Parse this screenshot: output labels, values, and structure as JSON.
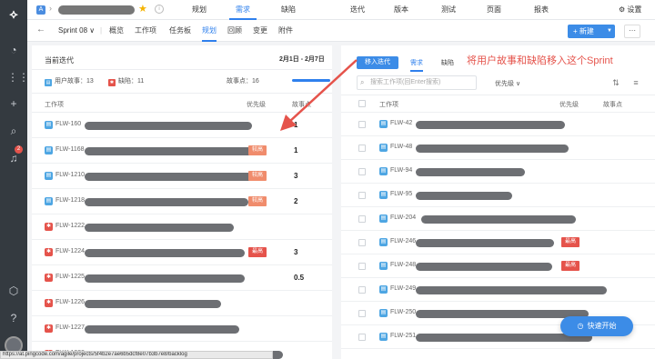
{
  "topbar": {
    "project_icon": "project-icon",
    "nav": [
      {
        "label": "规划",
        "active": false
      },
      {
        "label": "需求",
        "active": true
      },
      {
        "label": "缺陷",
        "active": false
      },
      {
        "label": "迭代",
        "active": false
      },
      {
        "label": "版本",
        "active": false
      },
      {
        "label": "测试",
        "active": false
      },
      {
        "label": "页面",
        "active": false
      },
      {
        "label": "报表",
        "active": false
      }
    ],
    "settings_label": "设置"
  },
  "subbar": {
    "sprint_select": "Sprint 08 ∨",
    "tabs": [
      {
        "label": "概览",
        "active": false
      },
      {
        "label": "工作项",
        "active": false
      },
      {
        "label": "任务板",
        "active": false
      },
      {
        "label": "规划",
        "active": true
      },
      {
        "label": "回顾",
        "active": false
      },
      {
        "label": "变更",
        "active": false
      },
      {
        "label": "附件",
        "active": false
      }
    ],
    "new_button": "+ 新建"
  },
  "left_panel": {
    "title": "当前迭代",
    "dates": "2月1日 - 2月7日",
    "stats": {
      "stories_label": "用户故事",
      "stories_count": "13",
      "bugs_label": "缺陷",
      "bugs_count": "11",
      "points_label": "故事点",
      "points_count": "16"
    },
    "columns": {
      "item": "工作项",
      "priority": "优先级",
      "points": "故事点"
    },
    "rows": [
      {
        "type": "story",
        "code": "FLW-160",
        "priority": "",
        "points": "1"
      },
      {
        "type": "story",
        "code": "FLW-1168",
        "priority": "较高",
        "points": "1"
      },
      {
        "type": "story",
        "code": "FLW-1210",
        "priority": "较高",
        "points": "3"
      },
      {
        "type": "story",
        "code": "FLW-1218",
        "priority": "较高",
        "points": "2"
      },
      {
        "type": "bug",
        "code": "FLW-1222",
        "priority": "",
        "points": ""
      },
      {
        "type": "bug",
        "code": "FLW-1224",
        "priority": "最高",
        "points": "3"
      },
      {
        "type": "bug",
        "code": "FLW-1225",
        "priority": "",
        "points": "0.5"
      },
      {
        "type": "bug",
        "code": "FLW-1226",
        "priority": "",
        "points": ""
      },
      {
        "type": "bug",
        "code": "FLW-1227",
        "priority": "",
        "points": ""
      },
      {
        "type": "bug",
        "code": "FLW-1229",
        "priority": "",
        "points": ""
      }
    ]
  },
  "right_panel": {
    "move_button": "移入迭代",
    "tabs": [
      {
        "label": "需求",
        "active": true
      },
      {
        "label": "缺陷",
        "active": false
      }
    ],
    "annotation": "将用户故事和缺陷移入这个Sprint",
    "search_placeholder": "搜索工作项(回Enter搜索)",
    "priority_filter": "优先级 ∨",
    "columns": {
      "item": "工作项",
      "priority": "优先级",
      "points": "故事点"
    },
    "rows": [
      {
        "type": "story",
        "code": "FLW-42",
        "priority": ""
      },
      {
        "type": "story",
        "code": "FLW-48",
        "priority": ""
      },
      {
        "type": "story",
        "code": "FLW-94",
        "priority": ""
      },
      {
        "type": "story",
        "code": "FLW-95",
        "priority": ""
      },
      {
        "type": "story",
        "code": "FLW-204",
        "priority": ""
      },
      {
        "type": "story",
        "code": "FLW-246",
        "priority": "最高"
      },
      {
        "type": "story",
        "code": "FLW-248",
        "priority": "最高"
      },
      {
        "type": "story",
        "code": "FLW-249",
        "priority": ""
      },
      {
        "type": "story",
        "code": "FLW-250",
        "priority": ""
      },
      {
        "type": "story",
        "code": "FLW-251",
        "priority": ""
      }
    ]
  },
  "quick_start_button": "快速开始",
  "status_url": "https://at.pingcode.com/agile/projects/5f4b2e7ae6b5dcf8e07b3b7e8/backlog",
  "colors": {
    "accent": "#2f80ed",
    "story": "#4ea6e3",
    "bug": "#e5534b",
    "annotation": "#e5534b"
  }
}
